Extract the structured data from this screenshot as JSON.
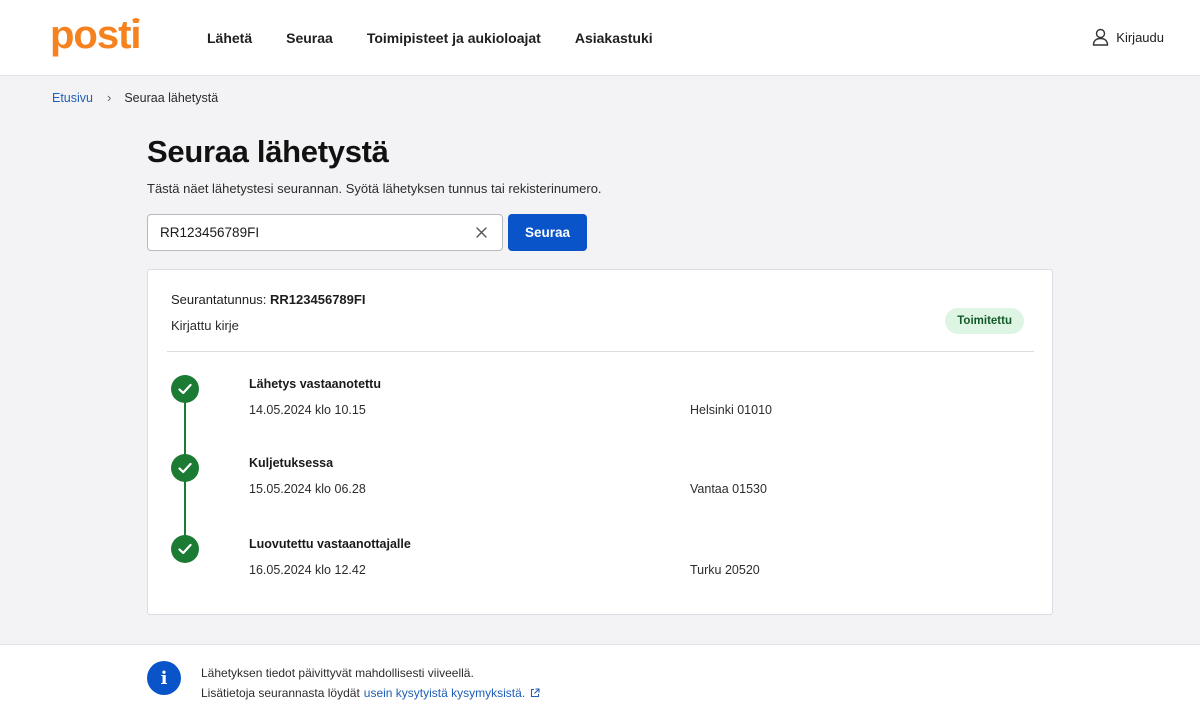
{
  "header": {
    "logo_text": "posti",
    "nav": [
      {
        "label": "Lähetä"
      },
      {
        "label": "Seuraa"
      },
      {
        "label": "Toimipisteet ja aukioloajat"
      },
      {
        "label": "Asiakastuki"
      }
    ],
    "login_label": "Kirjaudu"
  },
  "breadcrumb": {
    "home": "Etusivu",
    "separator": "›",
    "current": "Seuraa lähetystä"
  },
  "main": {
    "title": "Seuraa lähetystä",
    "intro": "Tästä näet lähetystesi seurannan. Syötä lähetyksen tunnus tai rekisterinumero.",
    "search": {
      "value": "RR123456789FI",
      "button_label": "Seuraa"
    }
  },
  "result": {
    "tracking_label": "Seurantatunnus:",
    "tracking_number": "RR123456789FI",
    "shipment_type": "Kirjattu kirje",
    "status": "Toimitettu",
    "events": [
      {
        "title": "Lähetys vastaanotettu",
        "time": "14.05.2024 klo 10.15",
        "place": "Helsinki 01010"
      },
      {
        "title": "Kuljetuksessa",
        "time": "15.05.2024 klo 06.28",
        "place": "Vantaa 01530"
      },
      {
        "title": "Luovutettu vastaanottajalle",
        "time": "16.05.2024 klo 12.42",
        "place": "Turku 20520"
      }
    ]
  },
  "info": {
    "line1": "Lähetyksen tiedot päivittyvät mahdollisesti viiveellä.",
    "line2_prefix": "Lisätietoja seurannasta löydät",
    "link_text": "usein kysytyistä kysymyksistä."
  },
  "colors": {
    "brand_orange": "#f5821f",
    "primary_blue": "#0a54c9",
    "success_green": "#1c7b32"
  }
}
